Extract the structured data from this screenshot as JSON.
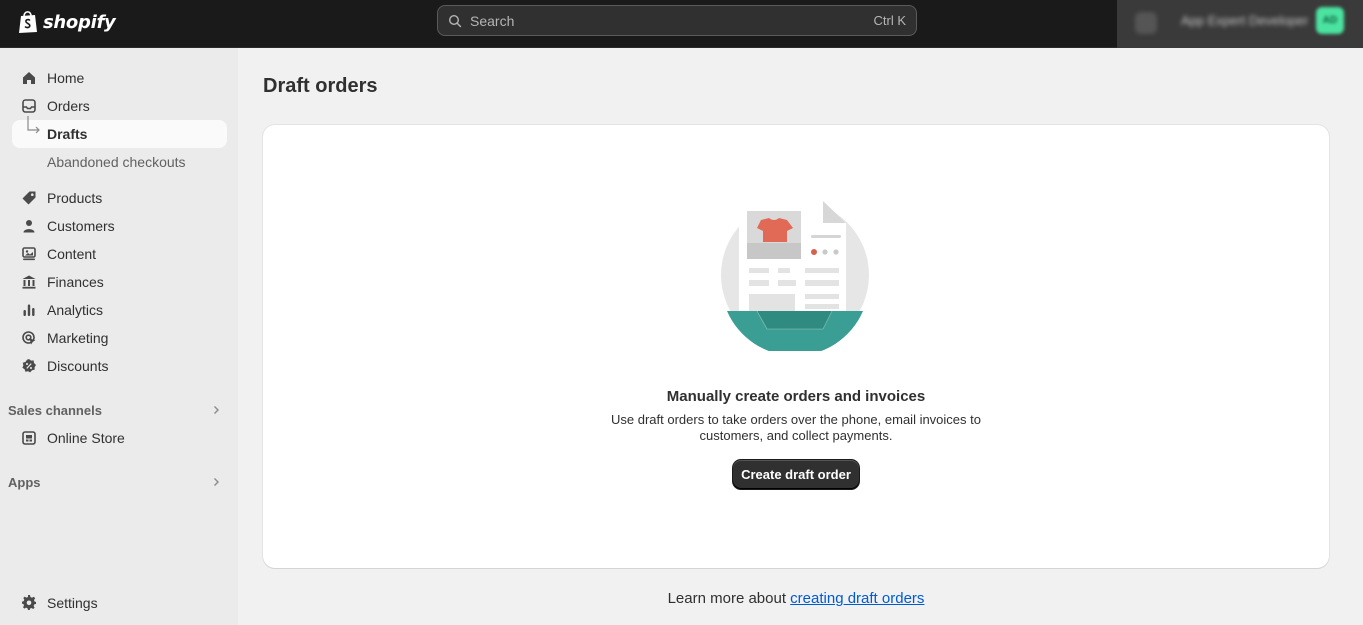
{
  "topbar": {
    "logo_text": "shopify",
    "search_placeholder": "Search",
    "search_shortcut": "Ctrl K",
    "store_name": "App Expert Developer",
    "avatar_initials": "AD"
  },
  "sidebar": {
    "items": [
      {
        "label": "Home",
        "icon": "home-icon"
      },
      {
        "label": "Orders",
        "icon": "orders-icon"
      },
      {
        "label": "Drafts",
        "icon": "sub-arrow-icon"
      },
      {
        "label": "Abandoned checkouts",
        "icon": ""
      },
      {
        "label": "Products",
        "icon": "tag-icon"
      },
      {
        "label": "Customers",
        "icon": "person-icon"
      },
      {
        "label": "Content",
        "icon": "content-icon"
      },
      {
        "label": "Finances",
        "icon": "bank-icon"
      },
      {
        "label": "Analytics",
        "icon": "bar-chart-icon"
      },
      {
        "label": "Marketing",
        "icon": "target-icon"
      },
      {
        "label": "Discounts",
        "icon": "discount-icon"
      },
      {
        "label": "Online Store",
        "icon": "store-icon"
      },
      {
        "label": "Settings",
        "icon": "gear-icon"
      }
    ],
    "sections": {
      "sales_channels": "Sales channels",
      "apps": "Apps"
    }
  },
  "main": {
    "title": "Draft orders",
    "empty_state": {
      "heading": "Manually create orders and invoices",
      "description": "Use draft orders to take orders over the phone, email invoices to customers, and collect payments.",
      "button_label": "Create draft order"
    },
    "footer": {
      "prefix": "Learn more about ",
      "link_label": "creating draft orders"
    }
  },
  "colors": {
    "topbar": "#1a1a1a",
    "sidebar": "#ebebeb",
    "page_bg": "#f1f1f1",
    "primary_button": "#303030",
    "link": "#005bd3",
    "illustration_teal": "#3a9e94",
    "illustration_red": "#d9604a"
  }
}
